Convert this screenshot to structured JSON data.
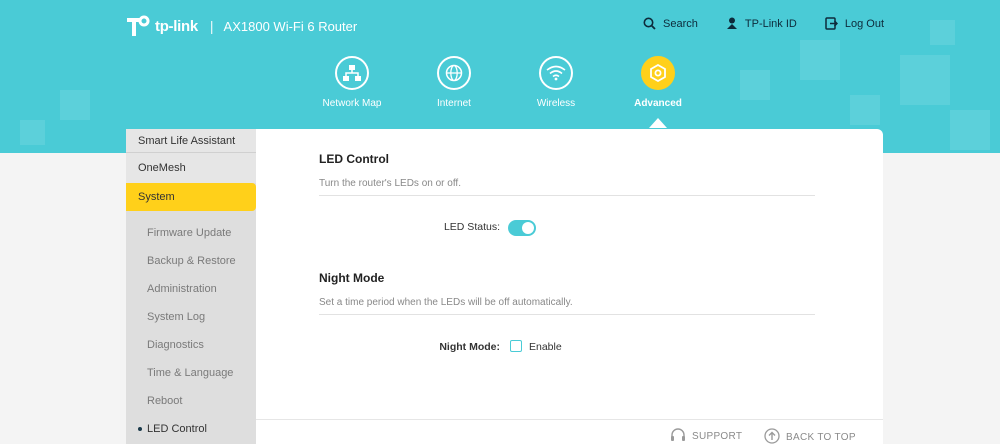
{
  "brand": {
    "logo_text": "tp-link",
    "model": "AX1800 Wi-Fi 6 Router",
    "primary_color": "#4acbd6",
    "accent_color": "#ffd01a"
  },
  "top_links": [
    {
      "label": "Search",
      "icon": "search-icon"
    },
    {
      "label": "TP-Link ID",
      "icon": "user-icon"
    },
    {
      "label": "Log Out",
      "icon": "logout-icon"
    }
  ],
  "nav": [
    {
      "label": "Network Map",
      "icon": "network-map-icon",
      "active": false
    },
    {
      "label": "Internet",
      "icon": "globe-icon",
      "active": false
    },
    {
      "label": "Wireless",
      "icon": "wifi-icon",
      "active": false
    },
    {
      "label": "Advanced",
      "icon": "gear-icon",
      "active": true
    }
  ],
  "sidebar": {
    "items": [
      {
        "label": "Smart Life Assistant"
      },
      {
        "label": "OneMesh"
      },
      {
        "label": "System"
      }
    ],
    "sub_items": [
      {
        "label": "Firmware Update"
      },
      {
        "label": "Backup & Restore"
      },
      {
        "label": "Administration"
      },
      {
        "label": "System Log"
      },
      {
        "label": "Diagnostics"
      },
      {
        "label": "Time & Language"
      },
      {
        "label": "Reboot"
      },
      {
        "label": "LED Control"
      }
    ]
  },
  "led_control": {
    "title": "LED Control",
    "description": "Turn the router's LEDs on or off.",
    "status_label": "LED Status:",
    "status_on": true
  },
  "night_mode": {
    "title": "Night Mode",
    "description": "Set a time period when the LEDs will be off automatically.",
    "mode_label": "Night Mode:",
    "enable_label": "Enable",
    "enabled": false
  },
  "footer": {
    "support": "SUPPORT",
    "back_to_top": "BACK TO TOP"
  }
}
